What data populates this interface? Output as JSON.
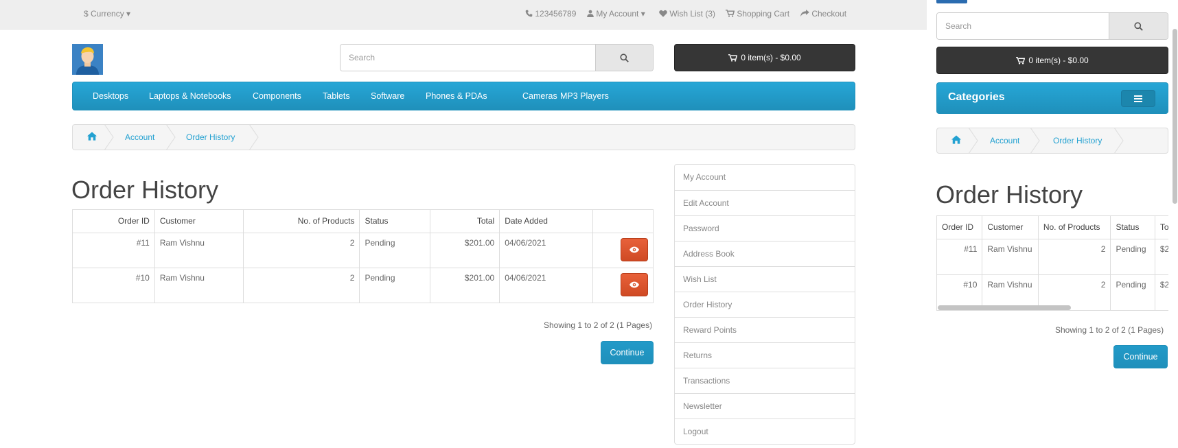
{
  "top_bar": {
    "currency": "$ Currency",
    "phone": "123456789",
    "my_account": "My Account",
    "wish_list": "Wish List (3)",
    "shopping_cart": "Shopping Cart",
    "checkout": "Checkout"
  },
  "search": {
    "placeholder": "Search"
  },
  "cart": {
    "label": "0 item(s) - $0.00"
  },
  "menu": {
    "items": [
      "Desktops",
      "Laptops & Notebooks",
      "Components",
      "Tablets",
      "Software",
      "Phones & PDAs",
      "Cameras",
      "MP3 Players"
    ]
  },
  "breadcrumb": {
    "items": [
      "Account",
      "Order History"
    ]
  },
  "page": {
    "title": "Order History"
  },
  "orders": {
    "headers": [
      "Order ID",
      "Customer",
      "No. of Products",
      "Status",
      "Total",
      "Date Added"
    ],
    "rows": [
      {
        "order_id": "#11",
        "customer": "Ram Vishnu",
        "products": "2",
        "status": "Pending",
        "total": "$201.00",
        "date": "04/06/2021"
      },
      {
        "order_id": "#10",
        "customer": "Ram Vishnu",
        "products": "2",
        "status": "Pending",
        "total": "$201.00",
        "date": "04/06/2021"
      }
    ]
  },
  "pagination": {
    "text": "Showing 1 to 2 of 2 (1 Pages)"
  },
  "buttons": {
    "continue": "Continue"
  },
  "account_menu": {
    "items": [
      "My Account",
      "Edit Account",
      "Password",
      "Address Book",
      "Wish List",
      "Order History",
      "Reward Points",
      "Returns",
      "Transactions",
      "Newsletter",
      "Logout"
    ]
  },
  "mobile": {
    "categories_label": "Categories",
    "visible_headers": [
      "Order ID",
      "Customer",
      "No. of Products",
      "Status"
    ]
  },
  "colors": {
    "menu_blue": "#229ac8",
    "cart_dark": "#363636",
    "view_button_red": "#da5230",
    "link_blue": "#23a1d1"
  }
}
